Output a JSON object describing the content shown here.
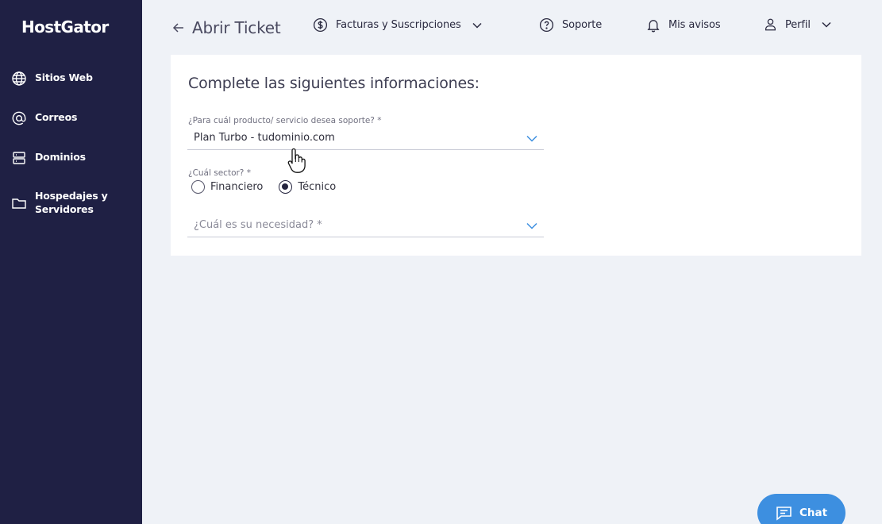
{
  "app": {
    "logo": "HostGator"
  },
  "sidebar": {
    "items": [
      {
        "label": "Sitios Web",
        "icon": "globe-icon"
      },
      {
        "label": "Correos",
        "icon": "at-icon"
      },
      {
        "label": "Dominios",
        "icon": "server-icon"
      },
      {
        "label": "Hospedajes y\nServidores",
        "icon": "folder-icon"
      }
    ]
  },
  "header": {
    "title": "Abrir Ticket",
    "billing": "Facturas y Suscripciones",
    "support": "Soporte",
    "notices": "Mis avisos",
    "profile": "Perfil"
  },
  "form": {
    "heading": "Complete las siguientes informaciones:",
    "product_label": "¿Para cuál producto/ servicio desea soporte? *",
    "product_value": "Plan Turbo - tudominio.com",
    "sector_label": "¿Cuál sector? *",
    "sector_options": [
      "Financiero",
      "Técnico"
    ],
    "sector_selected": "Técnico",
    "need_placeholder": "¿Cuál es su necesidad? *"
  },
  "chat": {
    "label": "Chat"
  },
  "colors": {
    "sidebar": "#1f2044",
    "accent": "#3d8fe0",
    "background": "#eff2f7"
  }
}
